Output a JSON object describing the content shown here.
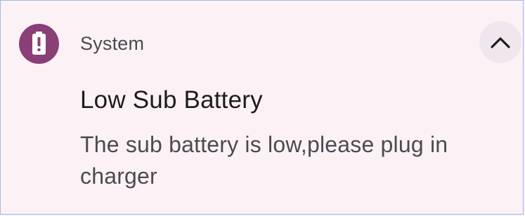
{
  "notification": {
    "app_name": "System",
    "title": "Low Sub Battery",
    "body": "The sub battery is low,please plug in charger",
    "icon": "battery-alert-icon",
    "collapse_icon": "chevron-up-icon",
    "colors": {
      "icon_bg": "#8a3f76",
      "card_bg": "#fcf2f6",
      "title": "#1d1b1e",
      "secondary": "#4c4a50"
    }
  }
}
